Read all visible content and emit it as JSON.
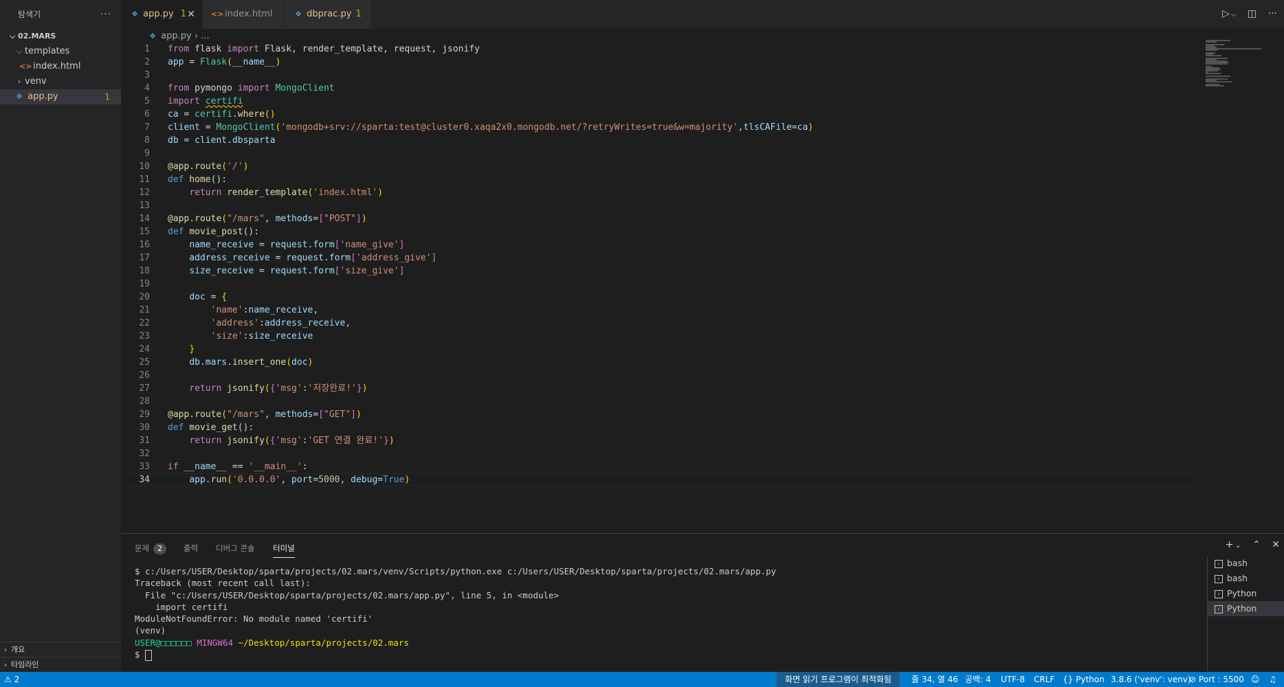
{
  "explorer": {
    "title": "탐색기",
    "more": "···",
    "project": "02.MARS",
    "tree": [
      {
        "label": "templates",
        "kind": "folder",
        "open": true
      },
      {
        "label": "index.html",
        "kind": "html"
      },
      {
        "label": "venv",
        "kind": "folder",
        "open": false
      },
      {
        "label": "app.py",
        "kind": "python",
        "badge": "1"
      }
    ],
    "outline": "개요",
    "timeline": "타임라인"
  },
  "tabs": [
    {
      "label": "app.py",
      "badge": "1",
      "active": true
    },
    {
      "label": "index.html",
      "active": false
    },
    {
      "label": "dbprac.py",
      "badge": "1",
      "active": false
    }
  ],
  "breadcrumb": {
    "file": "app.py",
    "rest": "..."
  },
  "editor": {
    "line_numbers": [
      "1",
      "2",
      "3",
      "4",
      "5",
      "6",
      "7",
      "8",
      "9",
      "10",
      "11",
      "12",
      "13",
      "14",
      "15",
      "16",
      "17",
      "18",
      "19",
      "20",
      "21",
      "22",
      "23",
      "24",
      "25",
      "26",
      "27",
      "28",
      "29",
      "30",
      "31",
      "32",
      "33",
      "34"
    ],
    "current_line": 34,
    "code": {
      "l1": [
        "from",
        " flask ",
        "import",
        " Flask, render_template, request, jsonify"
      ],
      "l2": [
        "app",
        " = ",
        "Flask",
        "(",
        "__name__",
        ")"
      ],
      "l4": [
        "from",
        " pymongo ",
        "import",
        " ",
        "MongoClient"
      ],
      "l5": [
        "import",
        " ",
        "certifi"
      ],
      "l6": [
        "ca",
        " = ",
        "certifi",
        ".",
        "where",
        "()"
      ],
      "l7": [
        "client",
        " = ",
        "MongoClient",
        "(",
        "'mongodb+srv://sparta:test@cluster0.xaqa2x0.mongodb.net/?retryWrites=true&w=majority'",
        ",",
        "tlsCAFile",
        "=",
        "ca",
        ")"
      ],
      "l8": [
        "db",
        " = ",
        "client",
        ".",
        "dbsparta"
      ],
      "l10": [
        "@app.route",
        "(",
        "'/'",
        ")"
      ],
      "l11": [
        "def",
        " ",
        "home",
        "():"
      ],
      "l12": [
        "    ",
        "return",
        " ",
        "render_template",
        "(",
        "'index.html'",
        ")"
      ],
      "l14": [
        "@app.route",
        "(",
        "\"/mars\"",
        ", ",
        "methods",
        "=",
        "[",
        "\"POST\"",
        "]",
        ")"
      ],
      "l15": [
        "def",
        " ",
        "movie_post",
        "():"
      ],
      "l16": [
        "    ",
        "name_receive",
        " = ",
        "request",
        ".",
        "form",
        "[",
        "'name_give'",
        "]"
      ],
      "l17": [
        "    ",
        "address_receive",
        " = ",
        "request",
        ".",
        "form",
        "[",
        "'address_give'",
        "]"
      ],
      "l18": [
        "    ",
        "size_receive",
        " = ",
        "request",
        ".",
        "form",
        "[",
        "'size_give'",
        "]"
      ],
      "l20": [
        "    ",
        "doc",
        " = ",
        "{"
      ],
      "l21": [
        "        ",
        "'name'",
        ":",
        "name_receive",
        ","
      ],
      "l22": [
        "        ",
        "'address'",
        ":",
        "address_receive",
        ","
      ],
      "l23": [
        "        ",
        "'size'",
        ":",
        "size_receive"
      ],
      "l24": [
        "    ",
        "}"
      ],
      "l25": [
        "    ",
        "db",
        ".",
        "mars",
        ".",
        "insert_one",
        "(",
        "doc",
        ")"
      ],
      "l27": [
        "    ",
        "return",
        " ",
        "jsonify",
        "(",
        "{",
        "'msg'",
        ":",
        "'저장완료!'",
        "}",
        ")"
      ],
      "l29": [
        "@app.route",
        "(",
        "\"/mars\"",
        ", ",
        "methods",
        "=",
        "[",
        "\"GET\"",
        "]",
        ")"
      ],
      "l30": [
        "def",
        " ",
        "movie_get",
        "():"
      ],
      "l31": [
        "    ",
        "return",
        " ",
        "jsonify",
        "(",
        "{",
        "'msg'",
        ":",
        "'GET 연결 완료!'",
        "}",
        ")"
      ],
      "l33": [
        "if",
        " ",
        "__name__",
        " == ",
        "'__main__'",
        ":"
      ],
      "l34": [
        "    ",
        "app",
        ".",
        "run",
        "(",
        "'0.0.0.0'",
        ", ",
        "port",
        "=",
        "5000",
        ", ",
        "debug",
        "=",
        "True",
        ")"
      ]
    }
  },
  "panel": {
    "tabs": [
      {
        "label": "문제",
        "badge": "2"
      },
      {
        "label": "출력"
      },
      {
        "label": "디버그 콘솔"
      },
      {
        "label": "터미널",
        "active": true
      }
    ],
    "terminal_lines": [
      "$ c:/Users/USER/Desktop/sparta/projects/02.mars/venv/Scripts/python.exe c:/Users/USER/Desktop/sparta/projects/02.mars/app.py",
      "Traceback (most recent call last):",
      "  File \"c:/Users/USER/Desktop/sparta/projects/02.mars/app.py\", line 5, in <module>",
      "    import certifi",
      "ModuleNotFoundError: No module named 'certifi'",
      "(venv)"
    ],
    "prompt_user": "USER@□□□□□□",
    "prompt_host": "MINGW64",
    "prompt_path": "~/Desktop/sparta/projects/02.mars",
    "prompt_symbol": "$",
    "terminals": [
      "bash",
      "bash",
      "Python",
      "Python"
    ],
    "actions": {
      "add": "+",
      "dropdown": "⌄",
      "maximize": "⌃",
      "close": "✕"
    }
  },
  "statusbar": {
    "warnings": "2",
    "screen_reader": "화면 읽기 프로그램이 최적화됨",
    "position": "줄 34, 열 46",
    "indent": "공백: 4",
    "encoding": "UTF-8",
    "eol": "CRLF",
    "language": "Python",
    "interpreter": "3.8.6 ('venv': venv)",
    "port": "Port : 5500"
  },
  "colors": {
    "statusbar": "#007acc",
    "editor_bg": "#1e1e1e",
    "sidebar_bg": "#252526",
    "modified": "#cca700"
  }
}
